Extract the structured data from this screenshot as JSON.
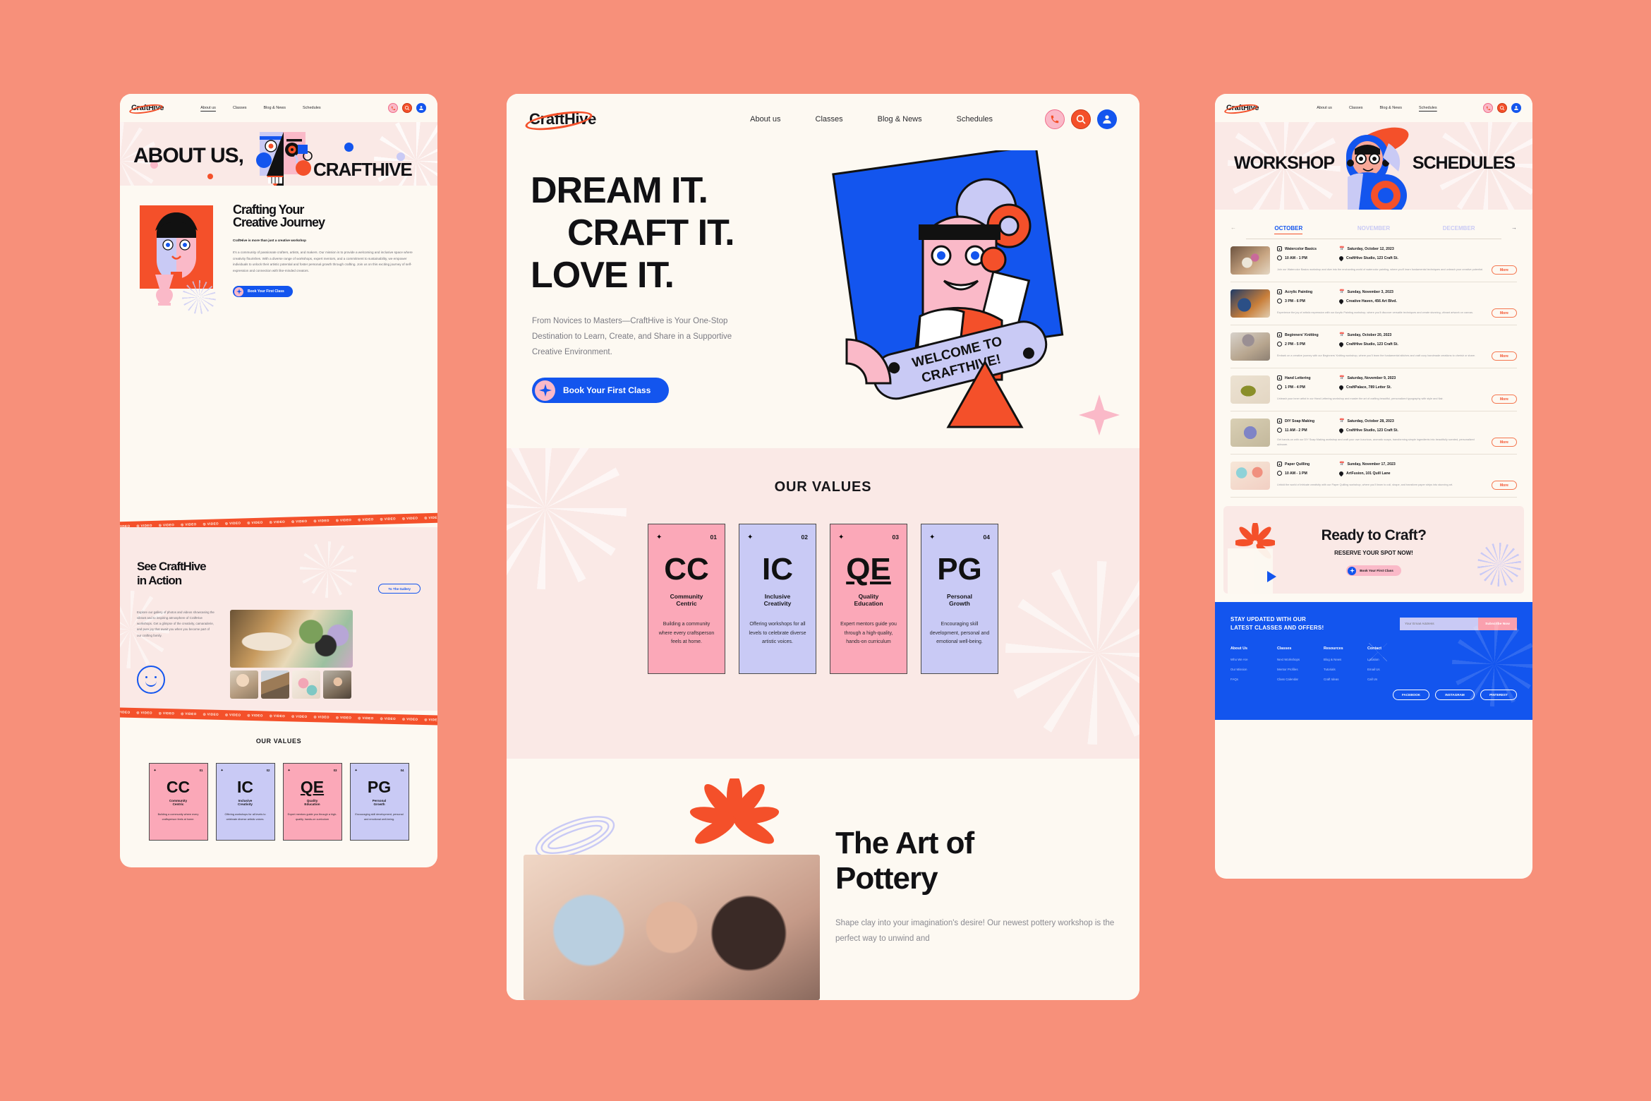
{
  "brand": {
    "name": "CraftHive",
    "accent_red": "#F4502A",
    "accent_blue": "#1355EE",
    "accent_pink": "#FAB9C8",
    "accent_lavender": "#C9CAF5",
    "page_bg": "#F7907A",
    "panel_bg": "#FDF9F2"
  },
  "nav": {
    "items": [
      {
        "label": "About us"
      },
      {
        "label": "Classes"
      },
      {
        "label": "Blog & News"
      },
      {
        "label": "Schedules"
      }
    ],
    "icons": [
      {
        "name": "phone-icon",
        "glyph": "✆"
      },
      {
        "name": "search-icon",
        "glyph": "⚲"
      },
      {
        "name": "user-account-icon",
        "glyph": "•"
      }
    ]
  },
  "about_panel": {
    "hero": {
      "title_left": "ABOUT US,",
      "title_right": "CRAFTHIVE"
    },
    "journey": {
      "heading_line1": "Crafting Your",
      "heading_line2": "Creative Journey",
      "lede": "CraftHive is more than just a creative workshop",
      "body": "It's a community of passionate crafters, artists, and makers. Our mission is to provide a welcoming and inclusive space where creativity flourishes. With a diverse range of workshops, expert mentors, and a commitment to sustainability, we empower individuals to unlock their artistic potential and foster personal growth through crafting. Join us on this exciting journey of self-expression and connection with like-minded creators.",
      "cta": "Book Your First Class"
    },
    "marquee_text": "VIDEO",
    "gallery": {
      "heading_line1": "See CraftHive",
      "heading_line2": "in Action",
      "button": "To The Gallery",
      "body": "Explore our gallery of photos and videos showcasing the vibrant and to inspiring atmosphere of CraftHive workshops. Get a glimpse of the creativity, camaraderie, and pure joy that await you when you become part of our crafting family."
    },
    "values_title": "OUR VALUES"
  },
  "home_panel": {
    "hero": {
      "line1": "DREAM IT.",
      "line2": "CRAFT IT.",
      "line3": "LOVE IT.",
      "subtitle": "From Novices to Masters—CraftHive is Your One-Stop Destination to Learn, Create, and Share in a Supportive Creative Environment.",
      "cta": "Book Your First Class",
      "badge_line1": "WELCOME TO",
      "badge_line2": "CRAFTHIVE!"
    },
    "values_title": "OUR VALUES",
    "pottery": {
      "line1": "The Art of",
      "line2": "Pottery",
      "body": "Shape clay into your imagination's desire! Our newest pottery workshop is the perfect way to unwind and"
    }
  },
  "schedules_panel": {
    "hero_title_left": "WORKSHOP",
    "hero_title_right": "SCHEDULES",
    "months": [
      {
        "label": "OCTOBER",
        "active": true
      },
      {
        "label": "NOVEMBER",
        "active": false
      },
      {
        "label": "DECEMBER",
        "active": false
      }
    ],
    "arrow_prev": "←",
    "arrow_next": "→",
    "more_label": "More",
    "rows": [
      {
        "title": "Watercolor Basics",
        "date": "Saturday, October 12, 2023",
        "time": "10 AM - 1 PM",
        "place": "CraftHive Studio, 123 Craft St.",
        "desc": "Join our Watercolor Basics workshop and dive into the enchanting world of watercolor painting, where you'll learn fundamental techniques and unleash your creative potential.",
        "thumb_colors": [
          "#6e5440",
          "#c8a582",
          "#e4d7c4"
        ]
      },
      {
        "title": "Acrylic Painting",
        "date": "Sunday, November 3, 2023",
        "time": "3 PM - 6 PM",
        "place": "Creative Haven, 456 Art Blvd.",
        "desc": "Experience the joy of artistic expression with our Acrylic Painting workshop, where you'll discover versatile techniques and create stunning, vibrant artwork on canvas.",
        "thumb_colors": [
          "#2b4f86",
          "#c97f3a",
          "#e0cdb0"
        ]
      },
      {
        "title": "Beginners' Knitting",
        "date": "Sunday, October 20, 2023",
        "time": "2 PM - 5 PM",
        "place": "CraftHive Studio, 123 Craft St.",
        "desc": "Embark on a creative journey with our Beginners' Knitting workshop, where you'll learn the fundamental stitches and craft cozy handmade creations to cherish or share.",
        "thumb_colors": [
          "#9a8f93",
          "#d8c9b2",
          "#b7a58e"
        ]
      },
      {
        "title": "Hand Lettering",
        "date": "Saturday, November 9, 2023",
        "time": "1 PM - 4 PM",
        "place": "CraftPalace, 789 Letter St.",
        "desc": "Unleash your inner artist in our Hand Lettering workshop and master the art of crafting beautiful, personalized typography with style and flair.",
        "thumb_colors": [
          "#ece2d2",
          "#8a8f2a",
          "#c9c46a"
        ]
      },
      {
        "title": "DIY Soap Making",
        "date": "Saturday, October 28, 2023",
        "time": "11 AM - 2 PM",
        "place": "CraftHive Studio, 123 Craft St.",
        "desc": "Get hands-on with our DIY Soap Making workshop and craft your own luxurious, aromatic soaps, transforming simple ingredients into beautifully scented, personalized skincare.",
        "thumb_colors": [
          "#7f84c6",
          "#cfc3a4",
          "#9aa0d6"
        ]
      },
      {
        "title": "Paper Quilling",
        "date": "Sunday, November 17, 2023",
        "time": "10 AM - 1 PM",
        "place": "ArtFusion, 101 Quill Lane",
        "desc": "Unfold the world of intricate creativity with our Paper Quilling workshop, where you'll learn to coil, shape, and transform paper strips into stunning art.",
        "thumb_colors": [
          "#f0b9a4",
          "#8fd2d8",
          "#f2e3c8"
        ]
      }
    ],
    "cta": {
      "title": "Ready to Craft?",
      "subtitle": "RESERVE YOUR SPOT NOW!",
      "button": "Book Your First Class"
    },
    "footer": {
      "headline_line1": "STAY UPDATED WITH OUR",
      "headline_line2": "LATEST CLASSES AND OFFERS!",
      "email_placeholder": "Your Email Address",
      "subscribe_label": "Subscribe Now",
      "columns": [
        {
          "heading": "About Us",
          "items": [
            "Who We Are",
            "Our Mission",
            "FAQs"
          ]
        },
        {
          "heading": "Classes",
          "items": [
            "Next Workshops",
            "Mentor Profiles",
            "Class Calendar"
          ]
        },
        {
          "heading": "Resources",
          "items": [
            "Blog & News",
            "Tutorials",
            "Craft Ideas"
          ]
        },
        {
          "heading": "Contact",
          "items": [
            "Location",
            "Email Us",
            "Call Us"
          ]
        }
      ],
      "socials": [
        "FACEBOOK",
        "INSTAGRAM",
        "PINTEREST"
      ]
    }
  },
  "values": [
    {
      "num": "01",
      "initials": "CC",
      "name_line1": "Community",
      "name_line2": "Centric",
      "desc": "Building a community where every craftsperson feels at home.",
      "color": "pink"
    },
    {
      "num": "02",
      "initials": "IC",
      "name_line1": "Inclusive",
      "name_line2": "Creativity",
      "desc": "Offering workshops for all levels to celebrate diverse artistic voices.",
      "color": "lav"
    },
    {
      "num": "03",
      "initials": "QE",
      "name_line1": "Quality",
      "name_line2": "Education",
      "desc": "Expert mentors guide you through a high-quality, hands-on curriculum",
      "color": "pink"
    },
    {
      "num": "04",
      "initials": "PG",
      "name_line1": "Personal",
      "name_line2": "Growth",
      "desc": "Encouraging skill development, personal and emotional well-being.",
      "color": "lav"
    }
  ]
}
